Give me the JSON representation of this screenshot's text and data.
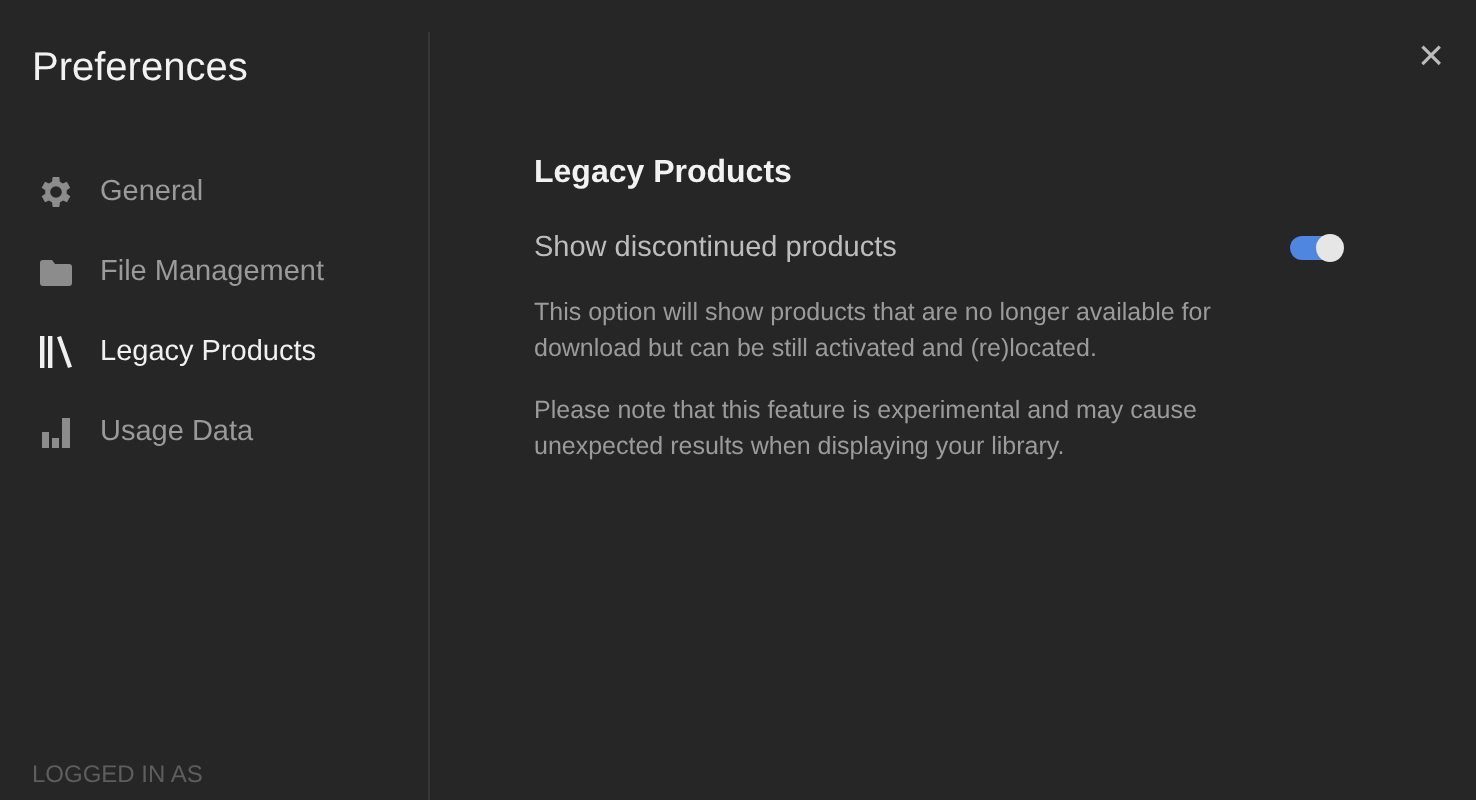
{
  "sidebar": {
    "title": "Preferences",
    "items": [
      {
        "label": "General",
        "kind": "gear",
        "selected": false
      },
      {
        "label": "File Management",
        "kind": "folder",
        "selected": false
      },
      {
        "label": "Legacy Products",
        "kind": "library",
        "selected": true
      },
      {
        "label": "Usage Data",
        "kind": "chart",
        "selected": false
      }
    ],
    "footer": "LOGGED IN AS"
  },
  "close": "×",
  "content": {
    "heading": "Legacy Products",
    "setting": {
      "label": "Show discontinued products",
      "on": true
    },
    "paragraphs": [
      "This option will show products that are no longer available for download but can be still activated and (re)located.",
      "Please note that this feature is experimental and may cause unexpected results when displaying your library."
    ]
  }
}
